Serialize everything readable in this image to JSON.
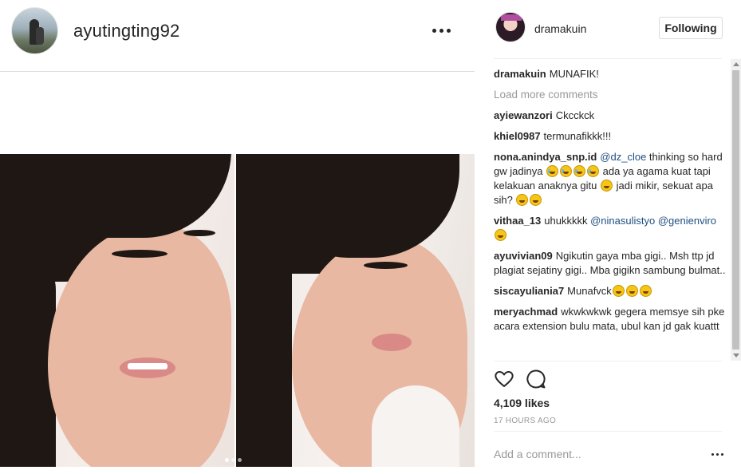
{
  "post_owner": {
    "username": "ayutingting92"
  },
  "commenter_header": {
    "username": "dramakuin",
    "follow_label": "Following"
  },
  "comments_panel": {
    "caption": {
      "user": "dramakuin",
      "text": "MUNAFIK!"
    },
    "load_more": "Load more comments",
    "items": [
      {
        "user": "ayiewanzori",
        "text": "Ckcckck"
      },
      {
        "user": "khiel0987",
        "text": "termunafikkk!!!"
      },
      {
        "user": "nona.anindya_snp.id",
        "mention": "@dz_cloe",
        "text_a": " thinking so hard gw jadinya ",
        "text_b": " ada ya agama kuat tapi kelakuan anaknya gitu ",
        "text_c": " jadi mikir, sekuat apa sih? "
      },
      {
        "user": "vithaa_13",
        "text": "uhukkkkk",
        "mention1": "@ninasulistyo",
        "mention2": "@genienviro"
      },
      {
        "user": "ayuvivian09",
        "text": "Ngikutin gaya mba gigi.. Msh ttp jd plagiat sejatiny gigi.. Mba gigikn sambung bulmat.."
      },
      {
        "user": "siscayuliania7",
        "text": "Munafvck"
      },
      {
        "user": "meryachmad",
        "text": "wkwkwkwk gegera memsye sih pke acara extension bulu mata, ubul kan jd gak kuattt"
      }
    ]
  },
  "engagement": {
    "likes": "4,109 likes",
    "time": "17 HOURS AGO"
  },
  "comment_box": {
    "placeholder": "Add a comment..."
  },
  "icons": {
    "like": "heart-icon",
    "comment": "comment-bubble-icon",
    "more": "more-options-icon"
  },
  "carousel": {
    "current": 1,
    "total": 3
  }
}
